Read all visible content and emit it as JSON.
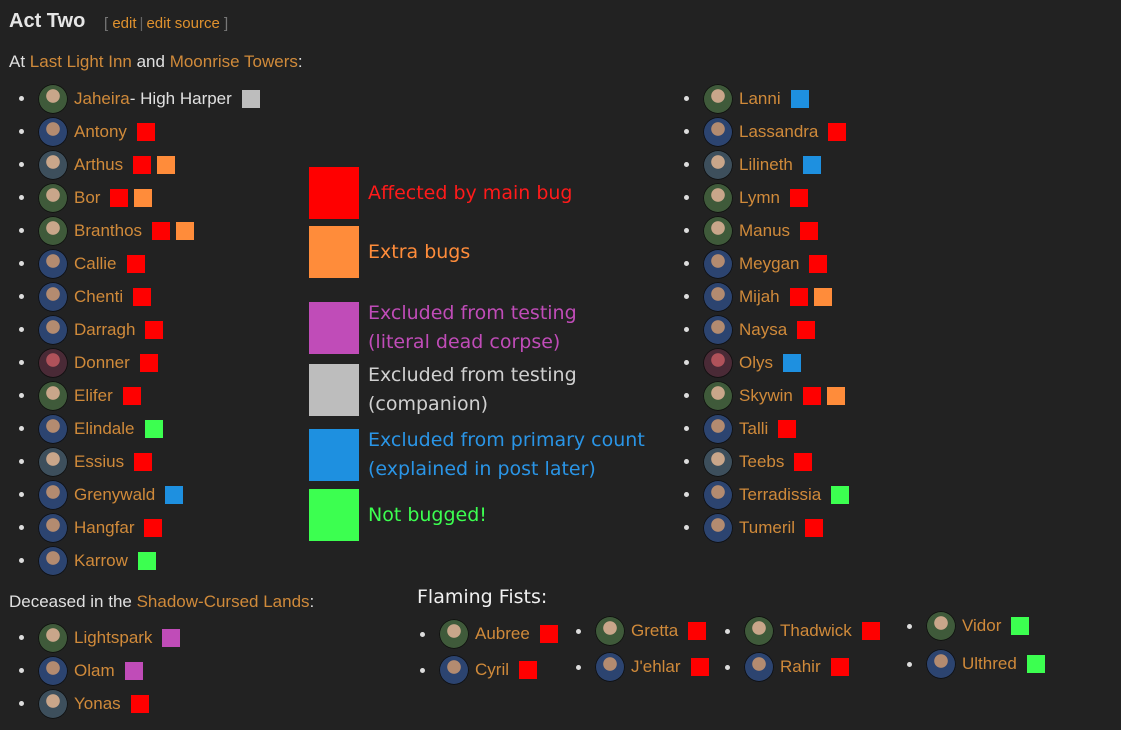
{
  "section": {
    "title": "Act Two",
    "edit_open": "[",
    "edit_label": "edit",
    "edit_sep": "|",
    "edit_source_label": "edit source",
    "edit_close": "]"
  },
  "intro": {
    "prefix": "At ",
    "location1": "Last Light Inn",
    "middle": " and ",
    "location2": "Moonrise Towers",
    "suffix": ":"
  },
  "colors": {
    "red": "#ff0000",
    "orange": "#ff8c3a",
    "purple": "#c04cb8",
    "gray": "#bdbdbd",
    "blue": "#1e90e0",
    "green": "#3cff50"
  },
  "legend": [
    {
      "color": "red",
      "text": "Affected by main bug"
    },
    {
      "color": "orange",
      "text": "Extra bugs"
    },
    {
      "color": "purple",
      "text": "Excluded from testing (literal dead corpse)"
    },
    {
      "color": "gray",
      "text": "Excluded from testing (companion)"
    },
    {
      "color": "blue",
      "text": "Excluded from primary count (explained in post later)"
    },
    {
      "color": "green",
      "text": "Not bugged!"
    }
  ],
  "left_list": [
    {
      "name": "Jaheira",
      "suffix": " - High Harper",
      "tags": [
        "gray"
      ]
    },
    {
      "name": "Antony",
      "tags": [
        "red"
      ]
    },
    {
      "name": "Arthus",
      "tags": [
        "red",
        "orange"
      ]
    },
    {
      "name": "Bor",
      "tags": [
        "red",
        "orange"
      ]
    },
    {
      "name": "Branthos",
      "tags": [
        "red",
        "orange"
      ]
    },
    {
      "name": "Callie",
      "tags": [
        "red"
      ]
    },
    {
      "name": "Chenti",
      "tags": [
        "red"
      ]
    },
    {
      "name": "Darragh",
      "tags": [
        "red"
      ]
    },
    {
      "name": "Donner",
      "tags": [
        "red"
      ]
    },
    {
      "name": "Elifer",
      "tags": [
        "red"
      ]
    },
    {
      "name": "Elindale",
      "tags": [
        "green"
      ]
    },
    {
      "name": "Essius",
      "tags": [
        "red"
      ]
    },
    {
      "name": "Grenywald",
      "tags": [
        "blue"
      ]
    },
    {
      "name": "Hangfar",
      "tags": [
        "red"
      ]
    },
    {
      "name": "Karrow",
      "tags": [
        "green"
      ]
    }
  ],
  "right_list": [
    {
      "name": "Lanni",
      "tags": [
        "blue"
      ]
    },
    {
      "name": "Lassandra",
      "tags": [
        "red"
      ]
    },
    {
      "name": "Lilineth",
      "tags": [
        "blue"
      ]
    },
    {
      "name": "Lymn",
      "tags": [
        "red"
      ]
    },
    {
      "name": "Manus",
      "tags": [
        "red"
      ]
    },
    {
      "name": "Meygan",
      "tags": [
        "red"
      ]
    },
    {
      "name": "Mijah",
      "tags": [
        "red",
        "orange"
      ]
    },
    {
      "name": "Naysa",
      "tags": [
        "red"
      ]
    },
    {
      "name": "Olys",
      "tags": [
        "blue"
      ]
    },
    {
      "name": "Skywin",
      "tags": [
        "red",
        "orange"
      ]
    },
    {
      "name": "Talli",
      "tags": [
        "red"
      ]
    },
    {
      "name": "Teebs",
      "tags": [
        "red"
      ]
    },
    {
      "name": "Terradissia",
      "tags": [
        "green"
      ]
    },
    {
      "name": "Tumeril",
      "tags": [
        "red"
      ]
    }
  ],
  "deceased": {
    "prefix": "Deceased in the ",
    "location": "Shadow-Cursed Lands",
    "suffix": ":",
    "list": [
      {
        "name": "Lightspark",
        "tags": [
          "purple"
        ]
      },
      {
        "name": "Olam",
        "tags": [
          "purple"
        ]
      },
      {
        "name": "Yonas",
        "tags": [
          "red"
        ]
      }
    ]
  },
  "flaming_fists": {
    "title": "Flaming Fists:",
    "columns": [
      [
        {
          "name": "Aubree",
          "tags": [
            "red"
          ]
        },
        {
          "name": "Cyril",
          "tags": [
            "red"
          ]
        }
      ],
      [
        {
          "name": "Gretta",
          "tags": [
            "red"
          ]
        },
        {
          "name": "J'ehlar",
          "tags": [
            "red"
          ]
        }
      ],
      [
        {
          "name": "Thadwick",
          "tags": [
            "red"
          ]
        },
        {
          "name": "Rahir",
          "tags": [
            "red"
          ]
        }
      ],
      [
        {
          "name": "Vidor",
          "tags": [
            "green"
          ]
        },
        {
          "name": "Ulthred",
          "tags": [
            "green"
          ]
        }
      ]
    ]
  }
}
